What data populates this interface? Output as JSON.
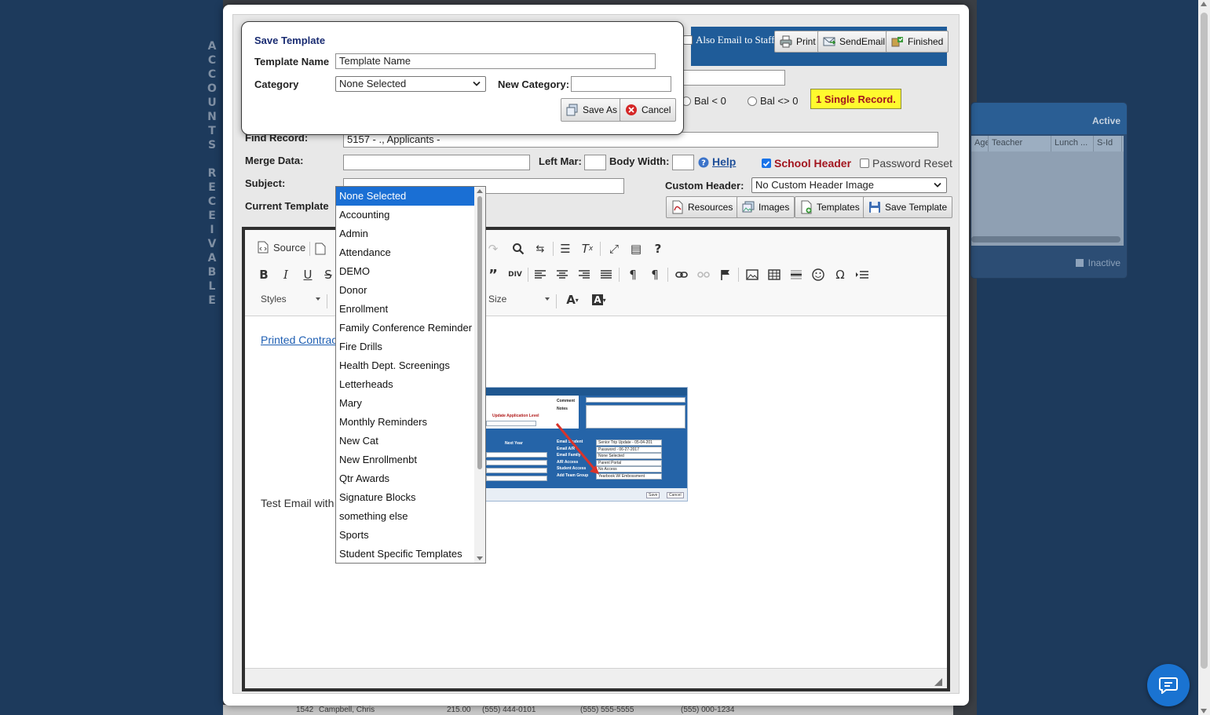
{
  "background": {
    "side_letters": [
      "A",
      "C",
      "C",
      "O",
      "U",
      "N",
      "T",
      "S",
      "",
      "R",
      "E",
      "C",
      "E",
      "I",
      "V",
      "A",
      "B",
      "L",
      "E"
    ],
    "panel": {
      "active_label": "Active",
      "columns": [
        "Age",
        "Teacher",
        "Lunch ...",
        "S-Id"
      ],
      "inactive_label": "Inactive"
    },
    "bottom_row": {
      "id": "1542",
      "name": "Campbell, Chris",
      "amount": "215.00",
      "phone1": "(555) 444-0101",
      "phone2": "(555) 555-5555",
      "phone3": "(555) 000-1234"
    }
  },
  "header_bar": {
    "also_email_staff": "Also Email to Staff",
    "print": "Print",
    "send_email": "SendEmail",
    "finished": "Finished"
  },
  "filters": {
    "bal_lt_zero": "Bal < 0",
    "bal_ne_zero": "Bal <> 0",
    "record_badge": "1 Single Record."
  },
  "form": {
    "find_record_label": "Find Record:",
    "find_record_value": "5157 - ., Applicants -",
    "merge_data_label": "Merge Data:",
    "left_mar_label": "Left Mar:",
    "body_width_label": "Body Width:",
    "help_label": "Help",
    "school_header_label": "School Header",
    "password_reset_label": "Password Reset",
    "subject_label": "Subject:",
    "custom_header_label": "Custom Header:",
    "custom_header_value": "No Custom Header Image",
    "current_template_label": "Current Template",
    "resources": "Resources",
    "images": "Images",
    "templates": "Templates",
    "save_template": "Save Template"
  },
  "editor": {
    "source_label": "Source",
    "styles_label": "Styles",
    "size_label": "Size",
    "link_text": "Printed Contract",
    "body_text": "Test Email with a"
  },
  "embedded_screenshot": {
    "update_app_level": "Update Application Level",
    "comment": "Comment",
    "notes": "Notes",
    "next_year": "Next Year",
    "rows": [
      {
        "label": "Email Student",
        "value": "Senior Trip Update - 05-04-201"
      },
      {
        "label": "Email A/R",
        "value": "Password - 06-27-2017"
      },
      {
        "label": "Email Family",
        "value": "None Selected"
      },
      {
        "label": "A/R Access",
        "value": "Parent Portal"
      },
      {
        "label": "Student Access",
        "value": "No Access"
      },
      {
        "label": "Add Team Group",
        "value": "Yearbook W/ Embossment"
      }
    ],
    "save": "Save",
    "cancel": "Cancel"
  },
  "save_dialog": {
    "title": "Save Template",
    "template_name_label": "Template Name",
    "template_name_value": "Template Name",
    "category_label": "Category",
    "category_value": "None Selected",
    "new_category_label": "New Category:",
    "new_category_value": "",
    "save_as": "Save As",
    "cancel": "Cancel"
  },
  "category_options": [
    "None Selected",
    "Accounting",
    "Admin",
    "Attendance",
    "DEMO",
    "Donor",
    "Enrollment",
    "Family Conference Reminder",
    "Fire Drills",
    "Health Dept. Screenings",
    "Letterheads",
    "Mary",
    "Monthly Reminders",
    "New Cat",
    "New Enrollmenbt",
    "Qtr Awards",
    "Signature Blocks",
    "something else",
    "Sports",
    "Student Specific Templates"
  ],
  "colors": {
    "page_bg": "#1d3a5c",
    "header_blue": "#1f5c99",
    "selection_blue": "#1a6fd4",
    "badge_yellow": "#fffa2e",
    "school_header_red": "#a3161f",
    "dialog_title": "#1a2c72"
  }
}
